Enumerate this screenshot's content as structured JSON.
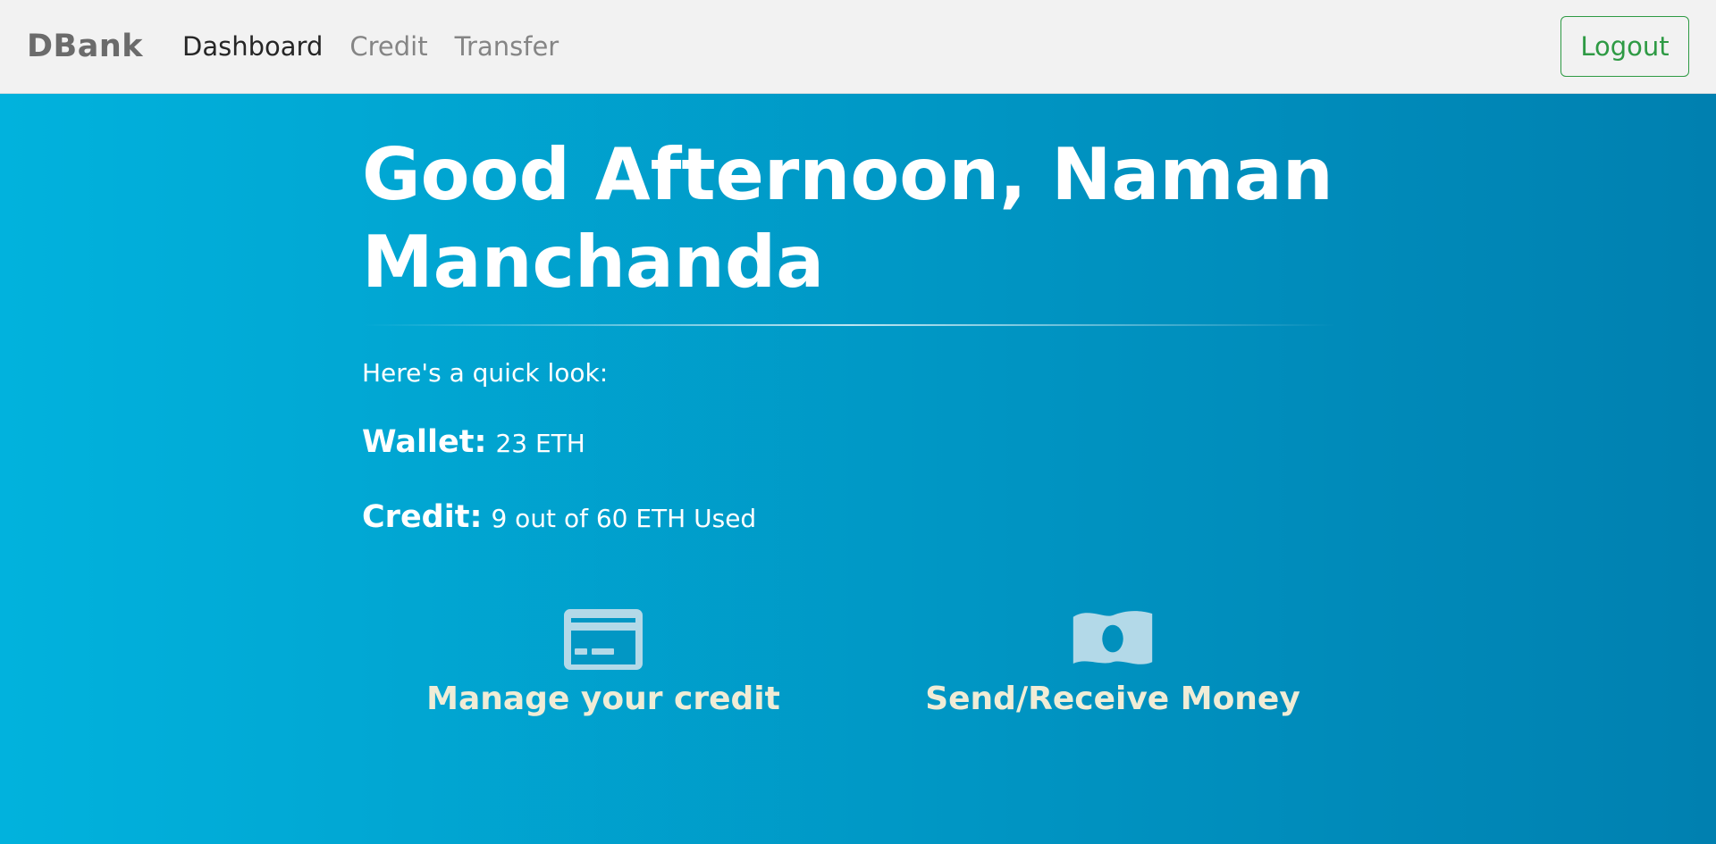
{
  "nav": {
    "brand": "DBank",
    "links": [
      {
        "label": "Dashboard",
        "active": true
      },
      {
        "label": "Credit",
        "active": false
      },
      {
        "label": "Transfer",
        "active": false
      }
    ],
    "logout_label": "Logout"
  },
  "hero": {
    "greeting": "Good Afternoon, Naman Manchanda",
    "quick_look": "Here's a quick look:",
    "wallet": {
      "label": "Wallet:",
      "value": "23 ETH"
    },
    "credit": {
      "label": "Credit:",
      "value": "9 out of 60 ETH Used"
    },
    "actions": [
      {
        "label": "Manage your credit",
        "icon": "credit-card-icon"
      },
      {
        "label": "Send/Receive Money",
        "icon": "money-bill-icon"
      }
    ]
  },
  "colors": {
    "gradient_start": "#01b2dd",
    "gradient_end": "#0080b0",
    "logout_green": "#2e9a44",
    "action_label": "#f0ecd6",
    "icon_fill": "#b3d9e8"
  }
}
